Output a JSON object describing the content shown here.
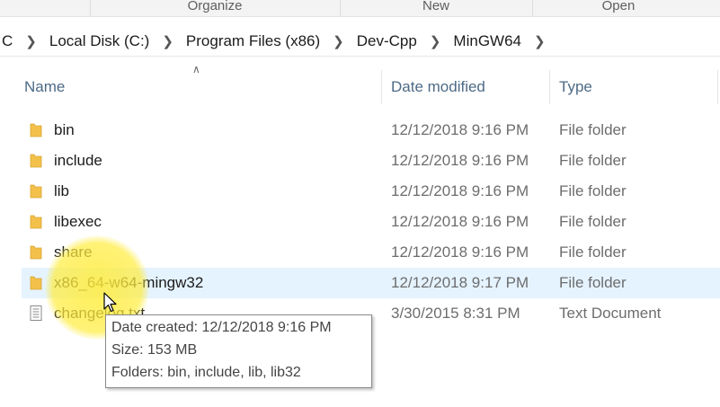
{
  "ribbon": {
    "groups": [
      "Organize",
      "New",
      "Open"
    ]
  },
  "address": {
    "crumbs": [
      "C",
      "Local Disk (C:)",
      "Program Files (x86)",
      "Dev-Cpp",
      "MinGW64"
    ]
  },
  "columns": {
    "name": "Name",
    "date": "Date modified",
    "type": "Type"
  },
  "files": [
    {
      "name": "bin",
      "date": "12/12/2018 9:16 PM",
      "type": "File folder",
      "icon": "folder-icon"
    },
    {
      "name": "include",
      "date": "12/12/2018 9:16 PM",
      "type": "File folder",
      "icon": "folder-icon"
    },
    {
      "name": "lib",
      "date": "12/12/2018 9:16 PM",
      "type": "File folder",
      "icon": "folder-icon"
    },
    {
      "name": "libexec",
      "date": "12/12/2018 9:16 PM",
      "type": "File folder",
      "icon": "folder-icon"
    },
    {
      "name": "share",
      "date": "12/12/2018 9:16 PM",
      "type": "File folder",
      "icon": "folder-icon"
    },
    {
      "name": "x86_64-w64-mingw32",
      "date": "12/12/2018 9:17 PM",
      "type": "File folder",
      "icon": "folder-icon",
      "selected": true
    },
    {
      "name": "changelog.txt",
      "date": "3/30/2015 8:31 PM",
      "type": "Text Document",
      "icon": "text-file-icon"
    }
  ],
  "tooltip": {
    "created": "Date created: 12/12/2018 9:16 PM",
    "size": "Size: 153 MB",
    "folders": "Folders: bin, include, lib, lib32"
  },
  "colors": {
    "folder": "#f3c04a",
    "selection": "#e5f3ff",
    "highlight": "#ffec3c"
  }
}
